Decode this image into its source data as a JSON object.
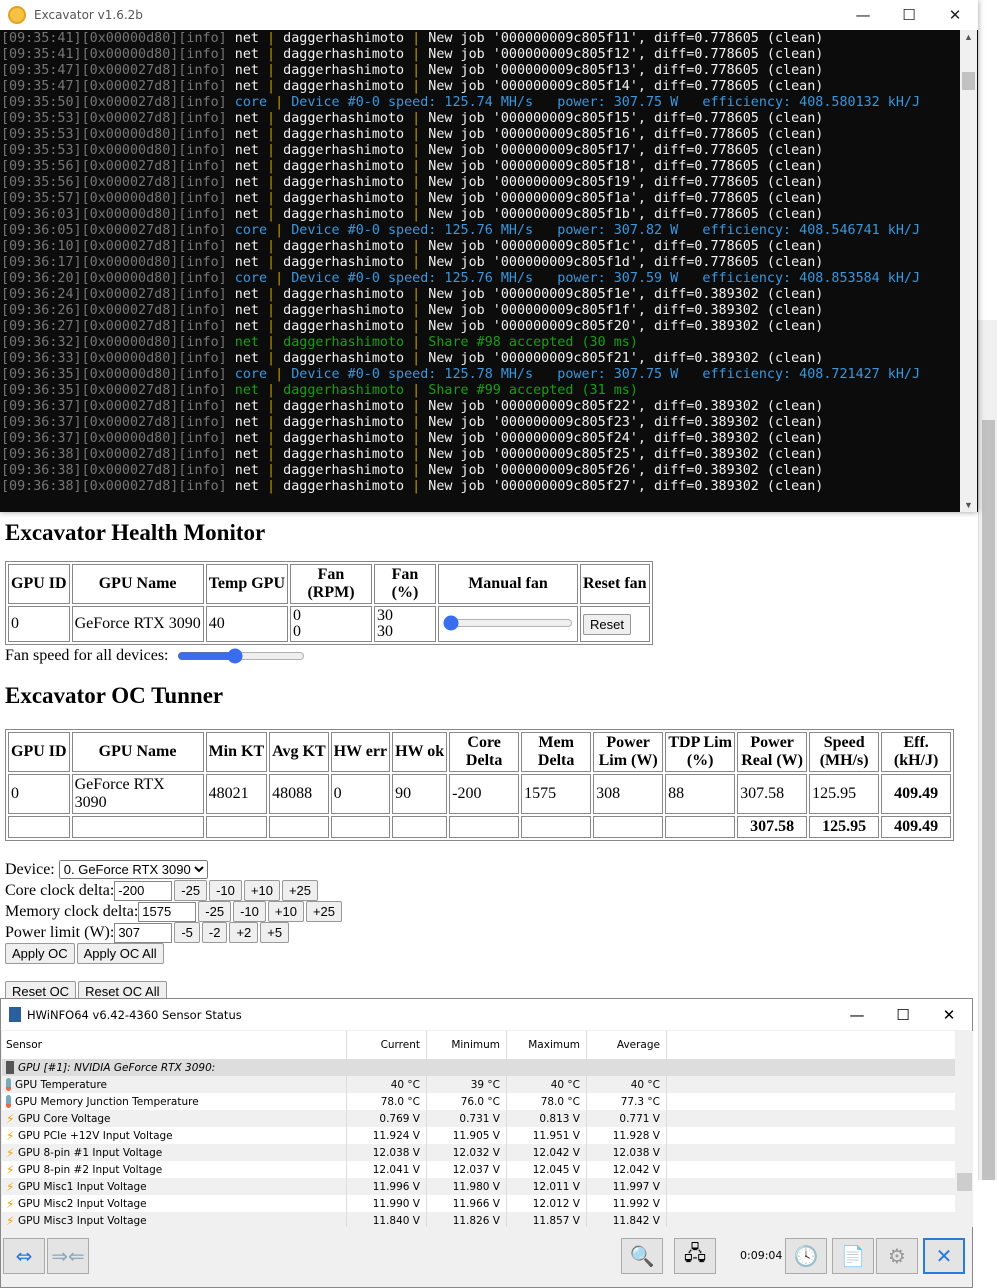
{
  "excavator": {
    "title": "Excavator v1.6.2b",
    "lines": [
      [
        "[09:35:41][0x00000d80][info]",
        "net",
        [
          "daggerhashimoto",
          "New job '000000009c805f11', diff=0.778605 (clean)"
        ]
      ],
      [
        "[09:35:41][0x00000d80][info]",
        "net",
        [
          "daggerhashimoto",
          "New job '000000009c805f12', diff=0.778605 (clean)"
        ]
      ],
      [
        "[09:35:47][0x000027d8][info]",
        "net",
        [
          "daggerhashimoto",
          "New job '000000009c805f13', diff=0.778605 (clean)"
        ]
      ],
      [
        "[09:35:47][0x000027d8][info]",
        "net",
        [
          "daggerhashimoto",
          "New job '000000009c805f14', diff=0.778605 (clean)"
        ]
      ],
      [
        "[09:35:50][0x000027d8][info]",
        "core",
        [
          "Device #0-0 speed: 125.74 MH/s   power: 307.75 W   efficiency: 408.580132 kH/J"
        ]
      ],
      [
        "[09:35:53][0x000027d8][info]",
        "net",
        [
          "daggerhashimoto",
          "New job '000000009c805f15', diff=0.778605 (clean)"
        ]
      ],
      [
        "[09:35:53][0x00000d80][info]",
        "net",
        [
          "daggerhashimoto",
          "New job '000000009c805f16', diff=0.778605 (clean)"
        ]
      ],
      [
        "[09:35:53][0x00000d80][info]",
        "net",
        [
          "daggerhashimoto",
          "New job '000000009c805f17', diff=0.778605 (clean)"
        ]
      ],
      [
        "[09:35:56][0x000027d8][info]",
        "net",
        [
          "daggerhashimoto",
          "New job '000000009c805f18', diff=0.778605 (clean)"
        ]
      ],
      [
        "[09:35:56][0x000027d8][info]",
        "net",
        [
          "daggerhashimoto",
          "New job '000000009c805f19', diff=0.778605 (clean)"
        ]
      ],
      [
        "[09:35:57][0x00000d80][info]",
        "net",
        [
          "daggerhashimoto",
          "New job '000000009c805f1a', diff=0.778605 (clean)"
        ]
      ],
      [
        "[09:36:03][0x00000d80][info]",
        "net",
        [
          "daggerhashimoto",
          "New job '000000009c805f1b', diff=0.778605 (clean)"
        ]
      ],
      [
        "[09:36:05][0x000027d8][info]",
        "core",
        [
          "Device #0-0 speed: 125.76 MH/s   power: 307.82 W   efficiency: 408.546741 kH/J"
        ]
      ],
      [
        "[09:36:10][0x000027d8][info]",
        "net",
        [
          "daggerhashimoto",
          "New job '000000009c805f1c', diff=0.778605 (clean)"
        ]
      ],
      [
        "[09:36:17][0x00000d80][info]",
        "net",
        [
          "daggerhashimoto",
          "New job '000000009c805f1d', diff=0.778605 (clean)"
        ]
      ],
      [
        "[09:36:20][0x00000d80][info]",
        "core",
        [
          "Device #0-0 speed: 125.76 MH/s   power: 307.59 W   efficiency: 408.853584 kH/J"
        ]
      ],
      [
        "[09:36:24][0x000027d8][info]",
        "net",
        [
          "daggerhashimoto",
          "New job '000000009c805f1e', diff=0.389302 (clean)"
        ]
      ],
      [
        "[09:36:26][0x000027d8][info]",
        "net",
        [
          "daggerhashimoto",
          "New job '000000009c805f1f', diff=0.389302 (clean)"
        ]
      ],
      [
        "[09:36:27][0x000027d8][info]",
        "net",
        [
          "daggerhashimoto",
          "New job '000000009c805f20', diff=0.389302 (clean)"
        ]
      ],
      [
        "[09:36:32][0x00000d80][info]",
        "net-ok",
        [
          "daggerhashimoto",
          "Share #98 accepted (30 ms)"
        ]
      ],
      [
        "[09:36:33][0x00000d80][info]",
        "net",
        [
          "daggerhashimoto",
          "New job '000000009c805f21', diff=0.389302 (clean)"
        ]
      ],
      [
        "[09:36:35][0x00000d80][info]",
        "core",
        [
          "Device #0-0 speed: 125.78 MH/s   power: 307.75 W   efficiency: 408.721427 kH/J"
        ]
      ],
      [
        "[09:36:35][0x000027d8][info]",
        "net-ok",
        [
          "daggerhashimoto",
          "Share #99 accepted (31 ms)"
        ]
      ],
      [
        "[09:36:37][0x000027d8][info]",
        "net",
        [
          "daggerhashimoto",
          "New job '000000009c805f22', diff=0.389302 (clean)"
        ]
      ],
      [
        "[09:36:37][0x000027d8][info]",
        "net",
        [
          "daggerhashimoto",
          "New job '000000009c805f23', diff=0.389302 (clean)"
        ]
      ],
      [
        "[09:36:37][0x00000d80][info]",
        "net",
        [
          "daggerhashimoto",
          "New job '000000009c805f24', diff=0.389302 (clean)"
        ]
      ],
      [
        "[09:36:38][0x000027d8][info]",
        "net",
        [
          "daggerhashimoto",
          "New job '000000009c805f25', diff=0.389302 (clean)"
        ]
      ],
      [
        "[09:36:38][0x000027d8][info]",
        "net",
        [
          "daggerhashimoto",
          "New job '000000009c805f26', diff=0.389302 (clean)"
        ]
      ],
      [
        "[09:36:38][0x000027d8][info]",
        "net",
        [
          "daggerhashimoto",
          "New job '000000009c805f27', diff=0.389302 (clean)"
        ]
      ]
    ]
  },
  "health": {
    "title": "Excavator Health Monitor",
    "headers": [
      "GPU ID",
      "GPU Name",
      "Temp GPU",
      "Fan (RPM)",
      "Fan (%)",
      "Manual fan",
      "Reset fan"
    ],
    "row": {
      "id": "0",
      "name": "GeForce RTX 3090",
      "temp": "40",
      "rpm": [
        "0",
        "0"
      ],
      "pct": [
        "30",
        "30"
      ],
      "manual_fan_pct": 0,
      "reset_label": "Reset"
    },
    "fan_all_label": "Fan speed for all devices:",
    "fan_all_pct": 45
  },
  "oc": {
    "title": "Excavator OC Tunner",
    "headers": [
      "GPU ID",
      "GPU Name",
      "Min KT",
      "Avg KT",
      "HW err",
      "HW ok",
      "Core Delta",
      "Mem Delta",
      "Power Lim (W)",
      "TDP Lim (%)",
      "Power Real (W)",
      "Speed (MH/s)",
      "Eff. (kH/J)"
    ],
    "row": [
      "0",
      "GeForce RTX 3090",
      "48021",
      "48088",
      "0",
      "90",
      "-200",
      "1575",
      "308",
      "88",
      "307.58",
      "125.95",
      "409.49"
    ],
    "totals": [
      "",
      "",
      "",
      "",
      "",
      "",
      "",
      "",
      "",
      "",
      "307.58",
      "125.95",
      "409.49"
    ],
    "device_label": "Device:",
    "device_value": "0. GeForce RTX 3090",
    "core_label": "Core clock delta:",
    "core_value": "-200",
    "core_steps": [
      "-25",
      "-10",
      "+10",
      "+25"
    ],
    "mem_label": "Memory clock delta:",
    "mem_value": "1575",
    "mem_steps": [
      "-25",
      "-10",
      "+10",
      "+25"
    ],
    "power_label": "Power limit (W):",
    "power_value": "307",
    "power_steps": [
      "-5",
      "-2",
      "+2",
      "+5"
    ],
    "apply": "Apply OC",
    "apply_all": "Apply OC All",
    "reset": "Reset OC",
    "reset_all": "Reset OC All"
  },
  "hwinfo": {
    "title": "HWiNFO64 v6.42-4360 Sensor Status",
    "columns": [
      "Sensor",
      "Current",
      "Minimum",
      "Maximum",
      "Average"
    ],
    "group": "GPU [#1]: NVIDIA GeForce RTX 3090:",
    "rows": [
      [
        "thermometer",
        "GPU Temperature",
        "40 °C",
        "39 °C",
        "40 °C",
        "40 °C"
      ],
      [
        "thermometer",
        "GPU Memory Junction Temperature",
        "78.0 °C",
        "76.0 °C",
        "78.0 °C",
        "77.3 °C"
      ],
      [
        "voltage",
        "GPU Core Voltage",
        "0.769 V",
        "0.731 V",
        "0.813 V",
        "0.771 V"
      ],
      [
        "voltage",
        "GPU PCIe +12V Input Voltage",
        "11.924 V",
        "11.905 V",
        "11.951 V",
        "11.928 V"
      ],
      [
        "voltage",
        "GPU 8-pin #1 Input Voltage",
        "12.038 V",
        "12.032 V",
        "12.042 V",
        "12.038 V"
      ],
      [
        "voltage",
        "GPU 8-pin #2 Input Voltage",
        "12.041 V",
        "12.037 V",
        "12.045 V",
        "12.042 V"
      ],
      [
        "voltage",
        "GPU Misc1 Input Voltage",
        "11.996 V",
        "11.980 V",
        "12.011 V",
        "11.997 V"
      ],
      [
        "voltage",
        "GPU Misc2 Input Voltage",
        "11.990 V",
        "11.966 V",
        "12.012 V",
        "11.992 V"
      ],
      [
        "voltage",
        "GPU Misc3 Input Voltage",
        "11.840 V",
        "11.826 V",
        "11.857 V",
        "11.842 V"
      ]
    ],
    "timer": "0:09:04"
  }
}
